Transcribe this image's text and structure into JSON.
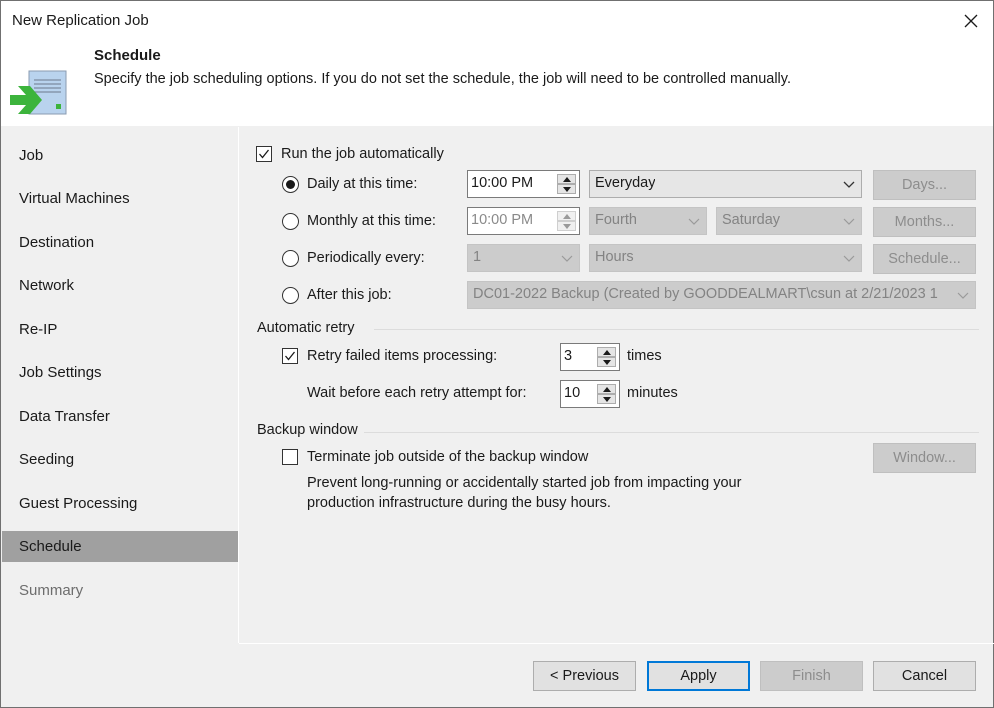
{
  "window": {
    "title": "New Replication Job",
    "close_icon": "close-icon"
  },
  "header": {
    "title": "Schedule",
    "description": "Specify the job scheduling options. If you do not set the schedule, the job will need to be controlled manually.",
    "icon": "schedule-document-arrow-icon",
    "accent_green": "#3cb43c"
  },
  "sidebar": {
    "items": [
      {
        "label": "Job",
        "state": "normal"
      },
      {
        "label": "Virtual Machines",
        "state": "normal"
      },
      {
        "label": "Destination",
        "state": "normal"
      },
      {
        "label": "Network",
        "state": "normal"
      },
      {
        "label": "Re-IP",
        "state": "normal"
      },
      {
        "label": "Job Settings",
        "state": "normal"
      },
      {
        "label": "Data Transfer",
        "state": "normal"
      },
      {
        "label": "Seeding",
        "state": "normal"
      },
      {
        "label": "Guest Processing",
        "state": "normal"
      },
      {
        "label": "Schedule",
        "state": "active"
      },
      {
        "label": "Summary",
        "state": "disabled"
      }
    ]
  },
  "schedule": {
    "run_automatically": {
      "label": "Run the job automatically",
      "checked": true
    },
    "daily": {
      "label": "Daily at this time:",
      "selected": true,
      "time": "10:00 PM",
      "frequency": "Everyday",
      "days_button": "Days..."
    },
    "monthly": {
      "label": "Monthly at this time:",
      "selected": false,
      "time": "10:00 PM",
      "week": "Fourth",
      "day": "Saturday",
      "months_button": "Months..."
    },
    "periodically": {
      "label": "Periodically every:",
      "selected": false,
      "value": "1",
      "unit": "Hours",
      "schedule_button": "Schedule..."
    },
    "after_job": {
      "label": "After this job:",
      "selected": false,
      "job": "DC01-2022 Backup (Created by GOODDEALMART\\csun at 2/21/2023 1"
    }
  },
  "automatic_retry": {
    "group_label": "Automatic retry",
    "retry": {
      "label": "Retry failed items processing:",
      "checked": true,
      "value": "3",
      "unit": "times"
    },
    "wait": {
      "label": "Wait before each retry attempt for:",
      "value": "10",
      "unit": "minutes"
    }
  },
  "backup_window": {
    "group_label": "Backup window",
    "terminate": {
      "label": "Terminate job outside of the backup window",
      "checked": false
    },
    "description_line1": "Prevent long-running or accidentally started job from impacting your",
    "description_line2": "production infrastructure during the busy hours.",
    "window_button": "Window..."
  },
  "footer": {
    "previous": "< Previous",
    "apply": "Apply",
    "finish": "Finish",
    "cancel": "Cancel",
    "focus_color": "#0078d7"
  }
}
